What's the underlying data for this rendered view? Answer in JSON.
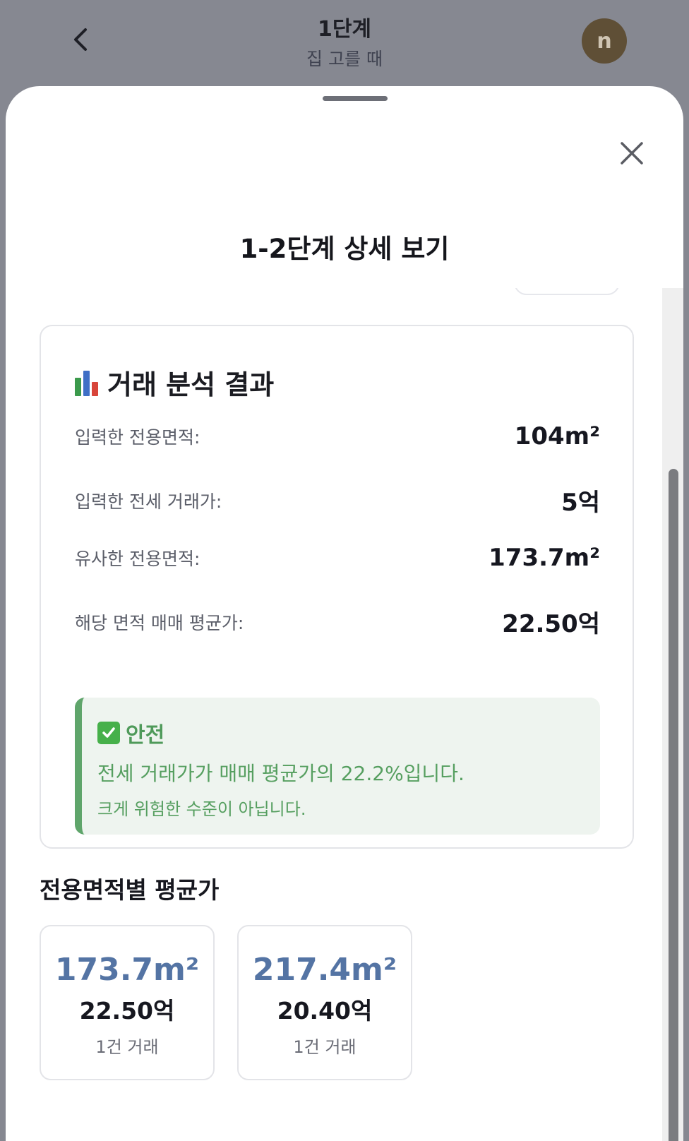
{
  "header": {
    "title": "1단계",
    "subtitle": "집 고를 때",
    "avatar_initial": "n"
  },
  "sheet": {
    "title": "1-2단계 상세 보기"
  },
  "analysis": {
    "title": "거래 분석 결과",
    "rows": [
      {
        "label": "입력한 전용면적:",
        "value": "104m²"
      },
      {
        "label": "입력한 전세 거래가:",
        "value": "5억"
      },
      {
        "label": "유사한 전용면적:",
        "value": "173.7m²"
      },
      {
        "label": "해당 면적 매매 평균가:",
        "value": "22.50억"
      }
    ],
    "result": {
      "status": "안전",
      "line1": "전세 거래가가 매매 평균가의 22.2%입니다.",
      "line2": "크게 위험한 수준이 아닙니다.",
      "color": "#5fa56b"
    }
  },
  "area_section": {
    "title": "전용면적별 평균가",
    "items": [
      {
        "size": "173.7m²",
        "price": "22.50억",
        "count": "1건 거래"
      },
      {
        "size": "217.4m²",
        "price": "20.40억",
        "count": "1건 거래"
      }
    ]
  },
  "icons": {
    "back": "chevron-left-icon",
    "close": "close-icon",
    "chart": "bar-chart-icon",
    "check": "check-box-icon"
  }
}
